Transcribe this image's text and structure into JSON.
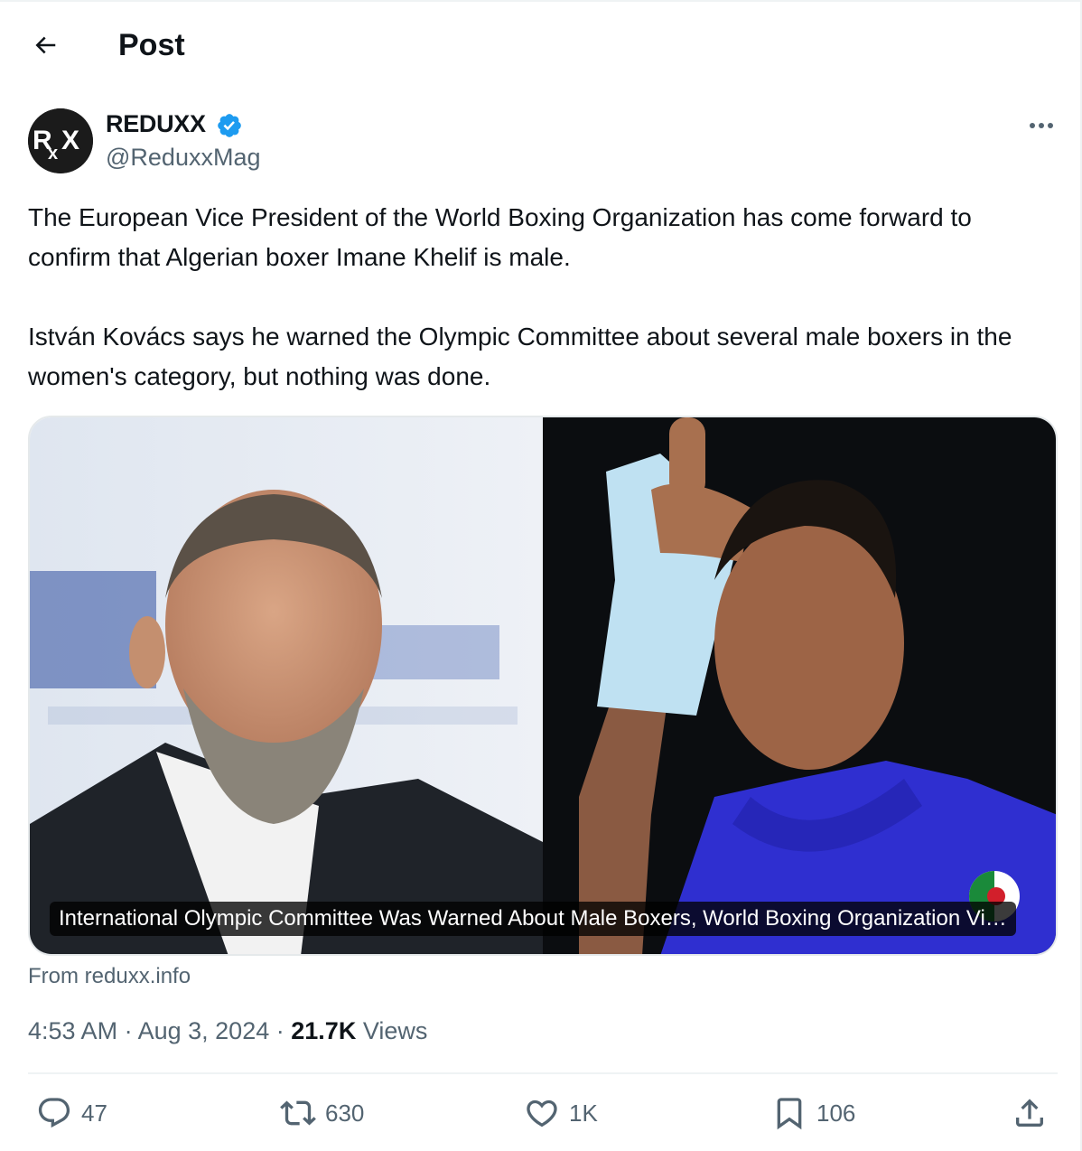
{
  "header": {
    "back_icon": "arrow-left-icon",
    "title": "Post"
  },
  "author": {
    "name": "REDUXX",
    "handle": "@ReduxxMag",
    "avatar_text": "RXX",
    "verified": true,
    "verified_color": "#1d9bf0",
    "more_icon": "ellipsis-icon"
  },
  "tweet": {
    "text": "The European Vice President of the World Boxing Organization has come forward to confirm that Algerian boxer Imane Khelif is male.\n\nIstván Kovács says he warned the Olympic Committee about several male boxers in the women's category, but nothing was done."
  },
  "card": {
    "caption": "International Olympic Committee Was Warned About Male Boxers, World Boxing Organization Vi…",
    "source": "From reduxx.info"
  },
  "meta": {
    "time": "4:53 AM",
    "separator": "·",
    "date": "Aug 3, 2024",
    "views_count": "21.7K",
    "views_label": "Views"
  },
  "actions": {
    "reply": {
      "icon": "reply-icon",
      "count": "47"
    },
    "retweet": {
      "icon": "retweet-icon",
      "count": "630"
    },
    "like": {
      "icon": "heart-icon",
      "count": "1K"
    },
    "bookmark": {
      "icon": "bookmark-icon",
      "count": "106"
    },
    "share": {
      "icon": "share-icon"
    }
  }
}
